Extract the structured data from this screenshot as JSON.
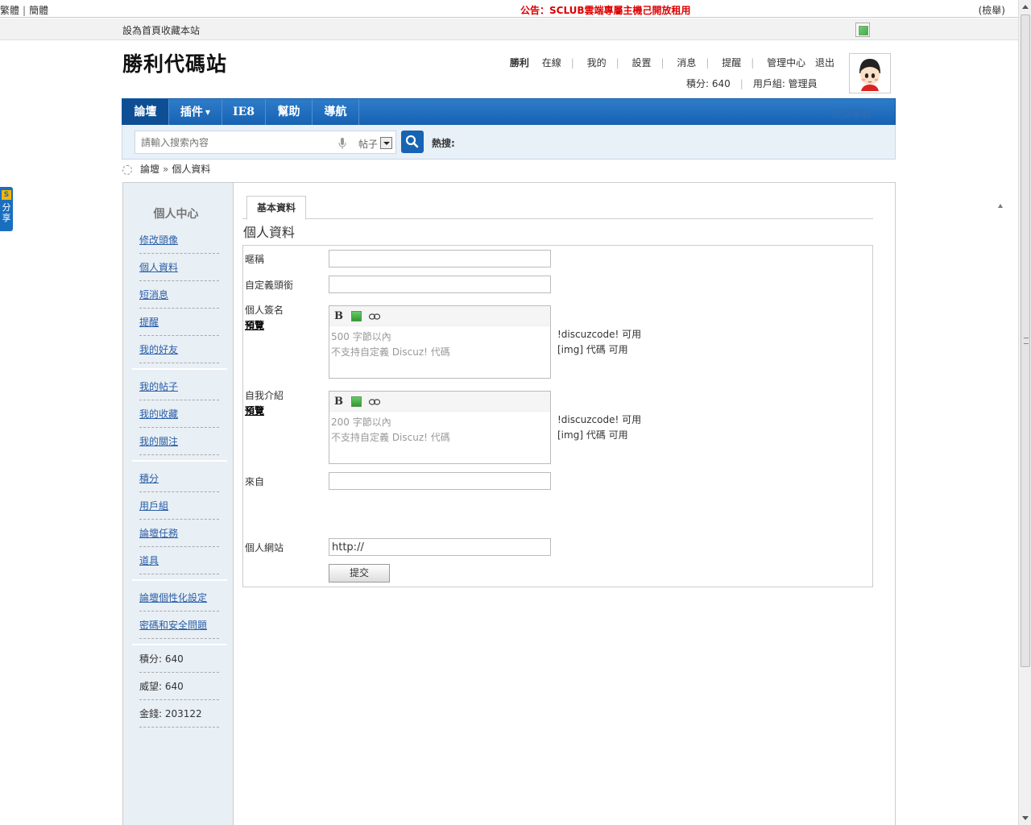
{
  "topbar": {
    "lang_traditional": "繁體",
    "lang_separator": "|",
    "lang_simplified": "簡體",
    "notice": "公告：SCLUB雲端專屬主機己開放租用",
    "report": "(檢舉)"
  },
  "subbar": {
    "links": "設為首頁收藏本站"
  },
  "header": {
    "logo": "勝利代碼站",
    "username": "勝利",
    "nav": [
      "在線",
      "我的",
      "設置",
      "消息",
      "提醒",
      "管理中心",
      "退出"
    ],
    "points": "積分: 640",
    "usergroup": "用戶組: 管理員"
  },
  "mainnav": {
    "tabs": [
      {
        "label": "論壇"
      },
      {
        "label": "插件"
      },
      {
        "label": "IE8"
      },
      {
        "label": "幫助"
      },
      {
        "label": "導航"
      }
    ],
    "quick": "快捷導航"
  },
  "search": {
    "placeholder": "請輸入搜索內容",
    "type": "帖子",
    "hot_label": "熱搜:"
  },
  "breadcrumb": {
    "forum": "論壇",
    "arrow": "»",
    "current": "個人資料"
  },
  "sidebar": {
    "title": "個人中心",
    "items": [
      "修改頭像",
      "個人資料",
      "短消息",
      "提醒",
      "我的好友",
      "我的帖子",
      "我的收藏",
      "我的關注",
      "積分",
      "用戶組",
      "論壇任務",
      "道具",
      "論壇個性化設定",
      "密碼和安全問題"
    ],
    "stats": [
      "積分: 640",
      "威望: 640",
      "金錢: 203122"
    ]
  },
  "profile": {
    "tab": "基本資料",
    "title": "個人資料",
    "nickname_label": "暱稱",
    "custom_title_label": "自定義頭銜",
    "signature_label": "個人簽名",
    "preview": "預覽",
    "signature_ph1": "500 字節以內",
    "signature_ph2": "不支持自定義 Discuz! 代碼",
    "intro_label": "自我介紹",
    "intro_ph1": "200 字節以內",
    "intro_ph2": "不支持自定義 Discuz! 代碼",
    "hint1": "!discuzcode! 可用",
    "hint2": "[img] 代碼 可用",
    "from_label": "來自",
    "website_label": "個人網站",
    "website_value": "http://",
    "submit": "提交"
  },
  "share": {
    "label1": "分",
    "label2": "享"
  },
  "colors": {
    "nav_blue": "#1863b4",
    "notice_red": "#dd0000",
    "link_blue": "#2b5ea6"
  }
}
